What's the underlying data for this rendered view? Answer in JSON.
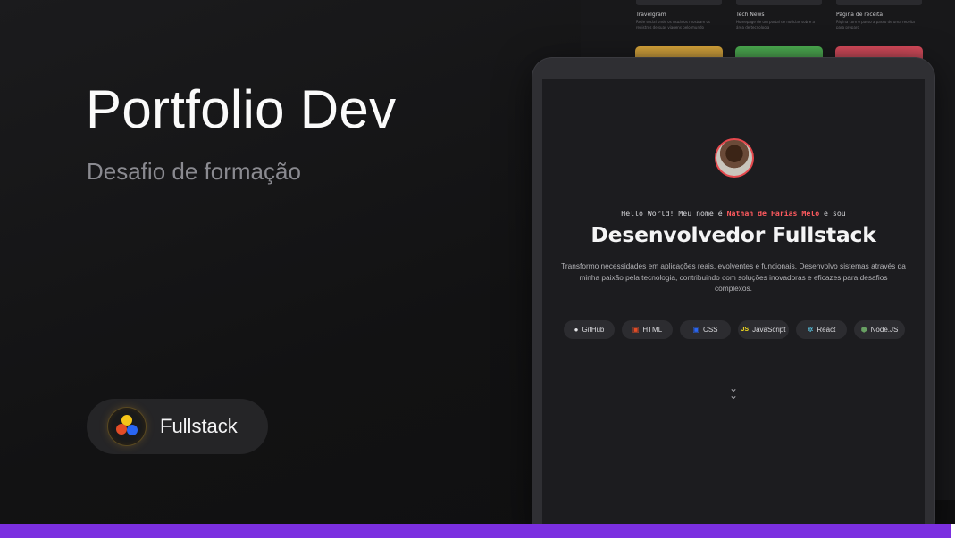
{
  "hero": {
    "title": "Portfolio Dev",
    "subtitle": "Desafio de formação"
  },
  "badge": {
    "label": "Fullstack",
    "icon": "fullstack-logo-icon"
  },
  "background_projects": [
    {
      "title": "Travelgram",
      "text": "Rede social onde os usuários mostram os registros de suas viagens pelo mundo",
      "color": "#2a2a2e"
    },
    {
      "title": "Tech News",
      "text": "Homepage de um portal de notícias sobre a área de tecnologia",
      "color": "#2a2a2e"
    },
    {
      "title": "Página de receita",
      "text": "Página com o passo a passo de uma receita para preparo",
      "color": "#2a2a2e"
    }
  ],
  "background_thumb_colors": [
    "#d9a63a",
    "#4caf50",
    "#d84a5a"
  ],
  "preview": {
    "greeting_prefix": "Hello World! Meu nome é ",
    "greeting_name": "Nathan de Farias Melo",
    "greeting_suffix": " e sou",
    "role": "Desenvolvedor Fullstack",
    "description": "Transformo necessidades em aplicações reais, evolventes e funcionais. Desenvolvo sistemas através da minha paixão pela tecnologia, contribuindo com soluções inovadoras e eficazes para desafios complexos.",
    "technologies": [
      {
        "label": "GitHub",
        "icon": "github-icon",
        "symbol": "●",
        "color": "#e4e4e7"
      },
      {
        "label": "HTML",
        "icon": "html-icon",
        "symbol": "▣",
        "color": "#e34c26"
      },
      {
        "label": "CSS",
        "icon": "css-icon",
        "symbol": "▣",
        "color": "#2965f1"
      },
      {
        "label": "JavaScript",
        "icon": "javascript-icon",
        "symbol": "JS",
        "color": "#f7df1e"
      },
      {
        "label": "React",
        "icon": "react-icon",
        "symbol": "✲",
        "color": "#61dafb"
      },
      {
        "label": "Node.JS",
        "icon": "nodejs-icon",
        "symbol": "⬢",
        "color": "#68a063"
      }
    ],
    "scroll_icon": "chevrons-down-icon"
  },
  "colors": {
    "accent_bar": "#7b2fe0",
    "highlight_name": "#ff5a5f"
  }
}
